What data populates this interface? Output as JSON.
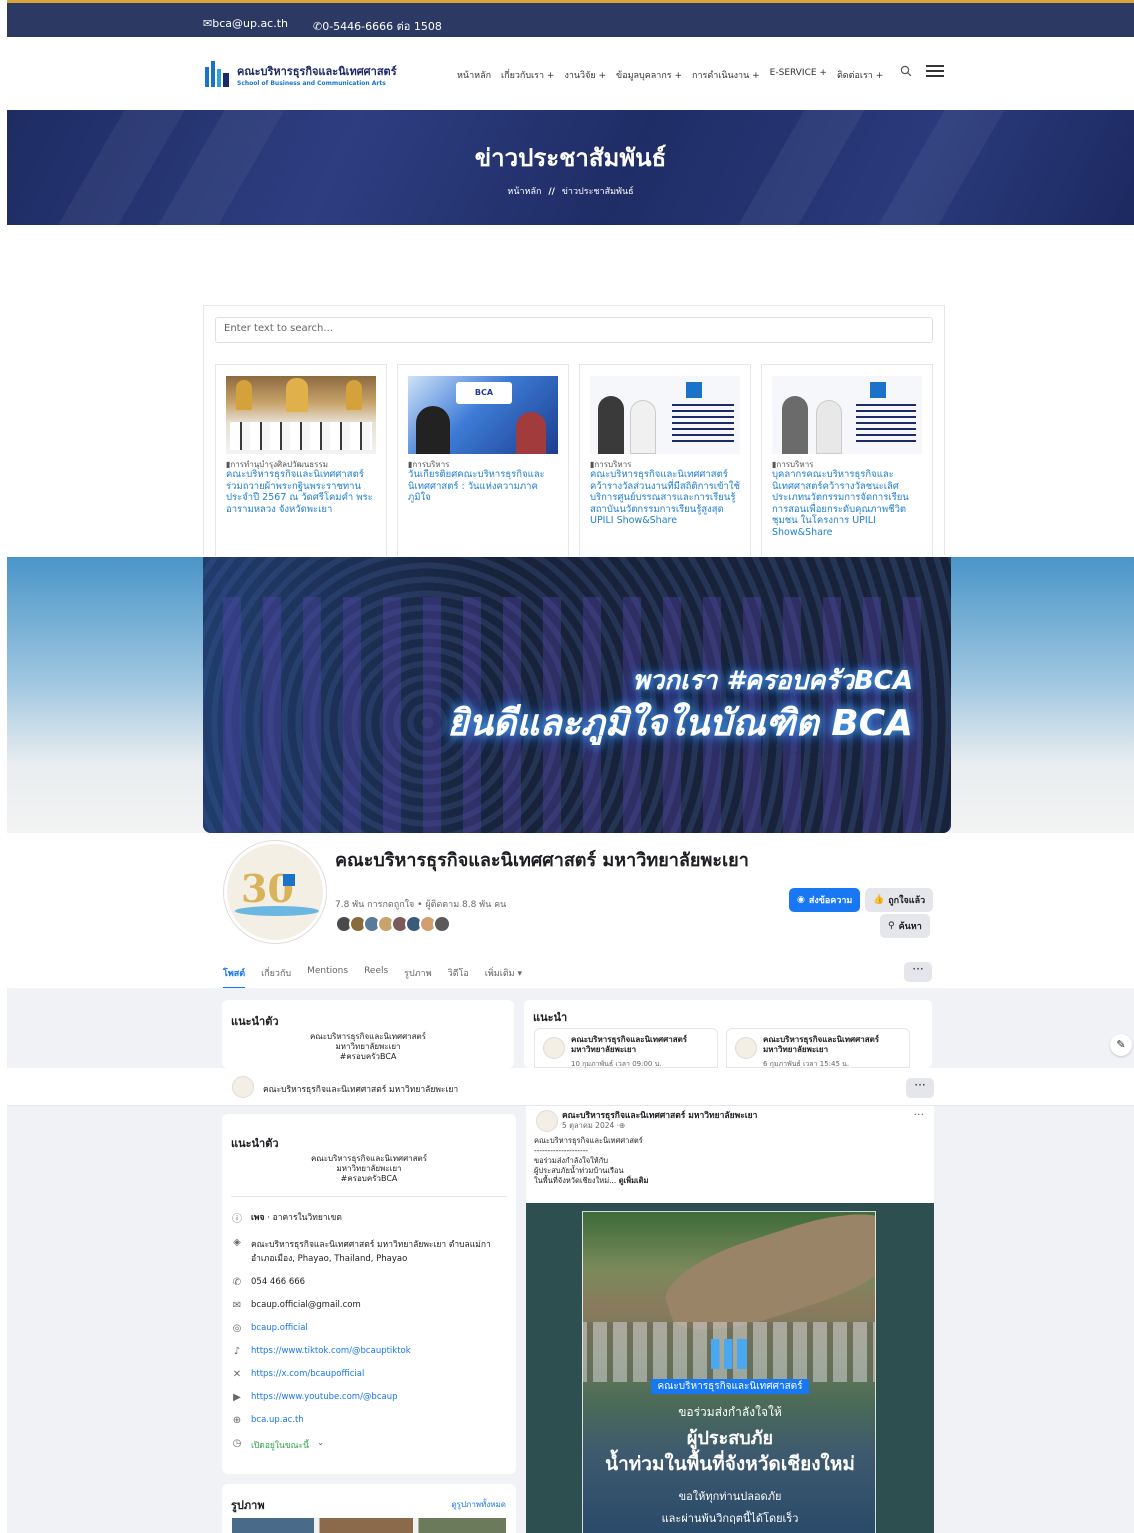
{
  "topbar": {
    "email": "bca@up.ac.th",
    "phone": "0-5446-6666 ต่อ 1508"
  },
  "site": {
    "name_th": "คณะบริหารธุรกิจและนิเทศศาสตร์",
    "name_en": "School of Business and Communication Arts"
  },
  "menu": [
    "หน้าหลัก",
    "เกี่ยวกับเรา +",
    "งานวิจัย +",
    "ข้อมูลบุคลากร +",
    "การดำเนินงาน +",
    "E-SERVICE +",
    "ติดต่อเรา +"
  ],
  "hero": {
    "title": "ข่าวประชาสัมพันธ์",
    "crumb_home": "หน้าหลัก",
    "crumb_sep": "//",
    "crumb_current": "ข่าวประชาสัมพันธ์"
  },
  "news": {
    "search_placeholder": "Enter text to search...",
    "items": [
      {
        "category": "การทำนุบำรุงศิลปวัฒนธรรม",
        "title": "คณะบริหารธุรกิจและนิเทศศาสตร์ ร่วมถวายผ้าพระกฐินพระราชทาน ประจำปี 2567 ณ วัดศรีโคมคำ พระอารามหลวง จังหวัดพะเยา"
      },
      {
        "category": "การบริหาร",
        "title": "วันเกียรติยศคณะบริหารธุรกิจและนิเทศศาสตร์ : วันแห่งความภาคภูมิใจ"
      },
      {
        "category": "การบริหาร",
        "title": "คณะบริหารธุรกิจและนิเทศศาสตร์ คว้ารางวัลส่วนงานที่มีสถิติการเข้าใช้บริการศูนย์บรรณสารและการเรียนรู้ สถาบันนวัตกรรมการเรียนรู้สูงสุด UPILI Show&Share"
      },
      {
        "category": "การบริหาร",
        "title": "บุคลากรคณะบริหารธุรกิจและนิเทศศาสตร์คว้ารางวัลชนะเลิศ ประเภทนวัตกรรมการจัดการเรียนการสอนเพื่อยกระดับคุณภาพชีวิตชุมชน ในโครงการ UPILI Show&Share"
      }
    ]
  },
  "cover": {
    "line1": "พวกเรา #ครอบครัวBCA",
    "line2": "ยินดีและภูมิใจในบัณฑิต BCA"
  },
  "profile": {
    "name": "คณะบริหารธุรกิจและนิเทศศาสตร์ มหาวิทยาลัยพะเยา",
    "stats": "7.8 พัน การกดถูกใจ • ผู้ติดตาม 8.8 พัน คน",
    "message_btn": "ส่งข้อความ",
    "liked_btn": "ถูกใจแล้ว",
    "search_btn": "ค้นหา",
    "more_btn": "···",
    "tabs": [
      "โพสต์",
      "เกี่ยวกับ",
      "Mentions",
      "Reels",
      "รูปภาพ",
      "วิดีโอ",
      "เพิ่มเติม ▾"
    ]
  },
  "intro": {
    "title": "แนะนำตัว",
    "bio1": "คณะบริหารธุรกิจและนิเทศศาสตร์",
    "bio2": "มหาวิทยาลัยพะเยา",
    "bio3": "#ครอบครัวBCA"
  },
  "recommend": {
    "title": "แนะนำ",
    "cards": [
      {
        "name": "คณะบริหารธุรกิจและนิเทศศาสตร์ มหาวิทยาลัยพะเยา",
        "time": "10 กุมภาพันธ์ เวลา 09:00 น."
      },
      {
        "name": "คณะบริหารธุรกิจและนิเทศศาสตร์ มหาวิทยาลัยพะเยา",
        "time": "6 กุมภาพันธ์ เวลา 15:45 น."
      }
    ]
  },
  "sticky": {
    "name": "คณะบริหารธุรกิจและนิเทศศาสตร์ มหาวิทยาลัยพะเยา",
    "more": "···"
  },
  "about": {
    "title": "แนะนำตัว",
    "bio1": "คณะบริหารธุรกิจและนิเทศศาสตร์",
    "bio2": "มหาวิทยาลัยพะเยา",
    "bio3": "#ครอบครัวBCA",
    "page_label": "เพจ",
    "page_type": " · อาคารในวิทยาเขต",
    "address": "คณะบริหารธุรกิจและนิเทศศาสตร์ มหาวิทยาลัยพะเยา ตำบลแม่กา อำเภอเมือง, Phayao, Thailand, Phayao",
    "phone": "054 466 666",
    "email": "bcaup.official@gmail.com",
    "instagram": "bcaup.official",
    "tiktok": "https://www.tiktok.com/@bcauptiktok",
    "x": "https://x.com/bcaupofficial",
    "youtube": "https://www.youtube.com/@bcaup",
    "website": "bca.up.ac.th",
    "hours": "เปิดอยู่ในขณะนี้"
  },
  "photos": {
    "title": "รูปภาพ",
    "see_all": "ดูรูปภาพทั้งหมด"
  },
  "post": {
    "author": "คณะบริหารธุรกิจและนิเทศศาสตร์ มหาวิทยาลัยพะเยา",
    "date": "5 ตุลาคม 2024 ·",
    "more": "···",
    "text1": "คณะบริหารธุรกิจและนิเทศศาสตร์",
    "text2": "--------------------",
    "text3": "ขอร่วมส่งกำลังใจให้กับ",
    "text4": "ผู้ประสบภัยน้ำท่วมบ้านเรือน",
    "text5": "ในพื้นที่จังหวัดเชียงใหม่... ",
    "see_more": "ดูเพิ่มเติม",
    "img_badge": "คณะบริหารธุรกิจและนิเทศศาสตร์",
    "img_l1": "ขอร่วมส่งกำลังใจให้",
    "img_l2": "ผู้ประสบภัย",
    "img_l3": "น้ำท่วมในพื้นที่จังหวัดเชียงใหม่",
    "img_l4": "ขอให้ทุกท่านปลอดภัย",
    "img_l5": "และผ่านพ้นวิกฤตนี้ได้โดยเร็ว"
  }
}
